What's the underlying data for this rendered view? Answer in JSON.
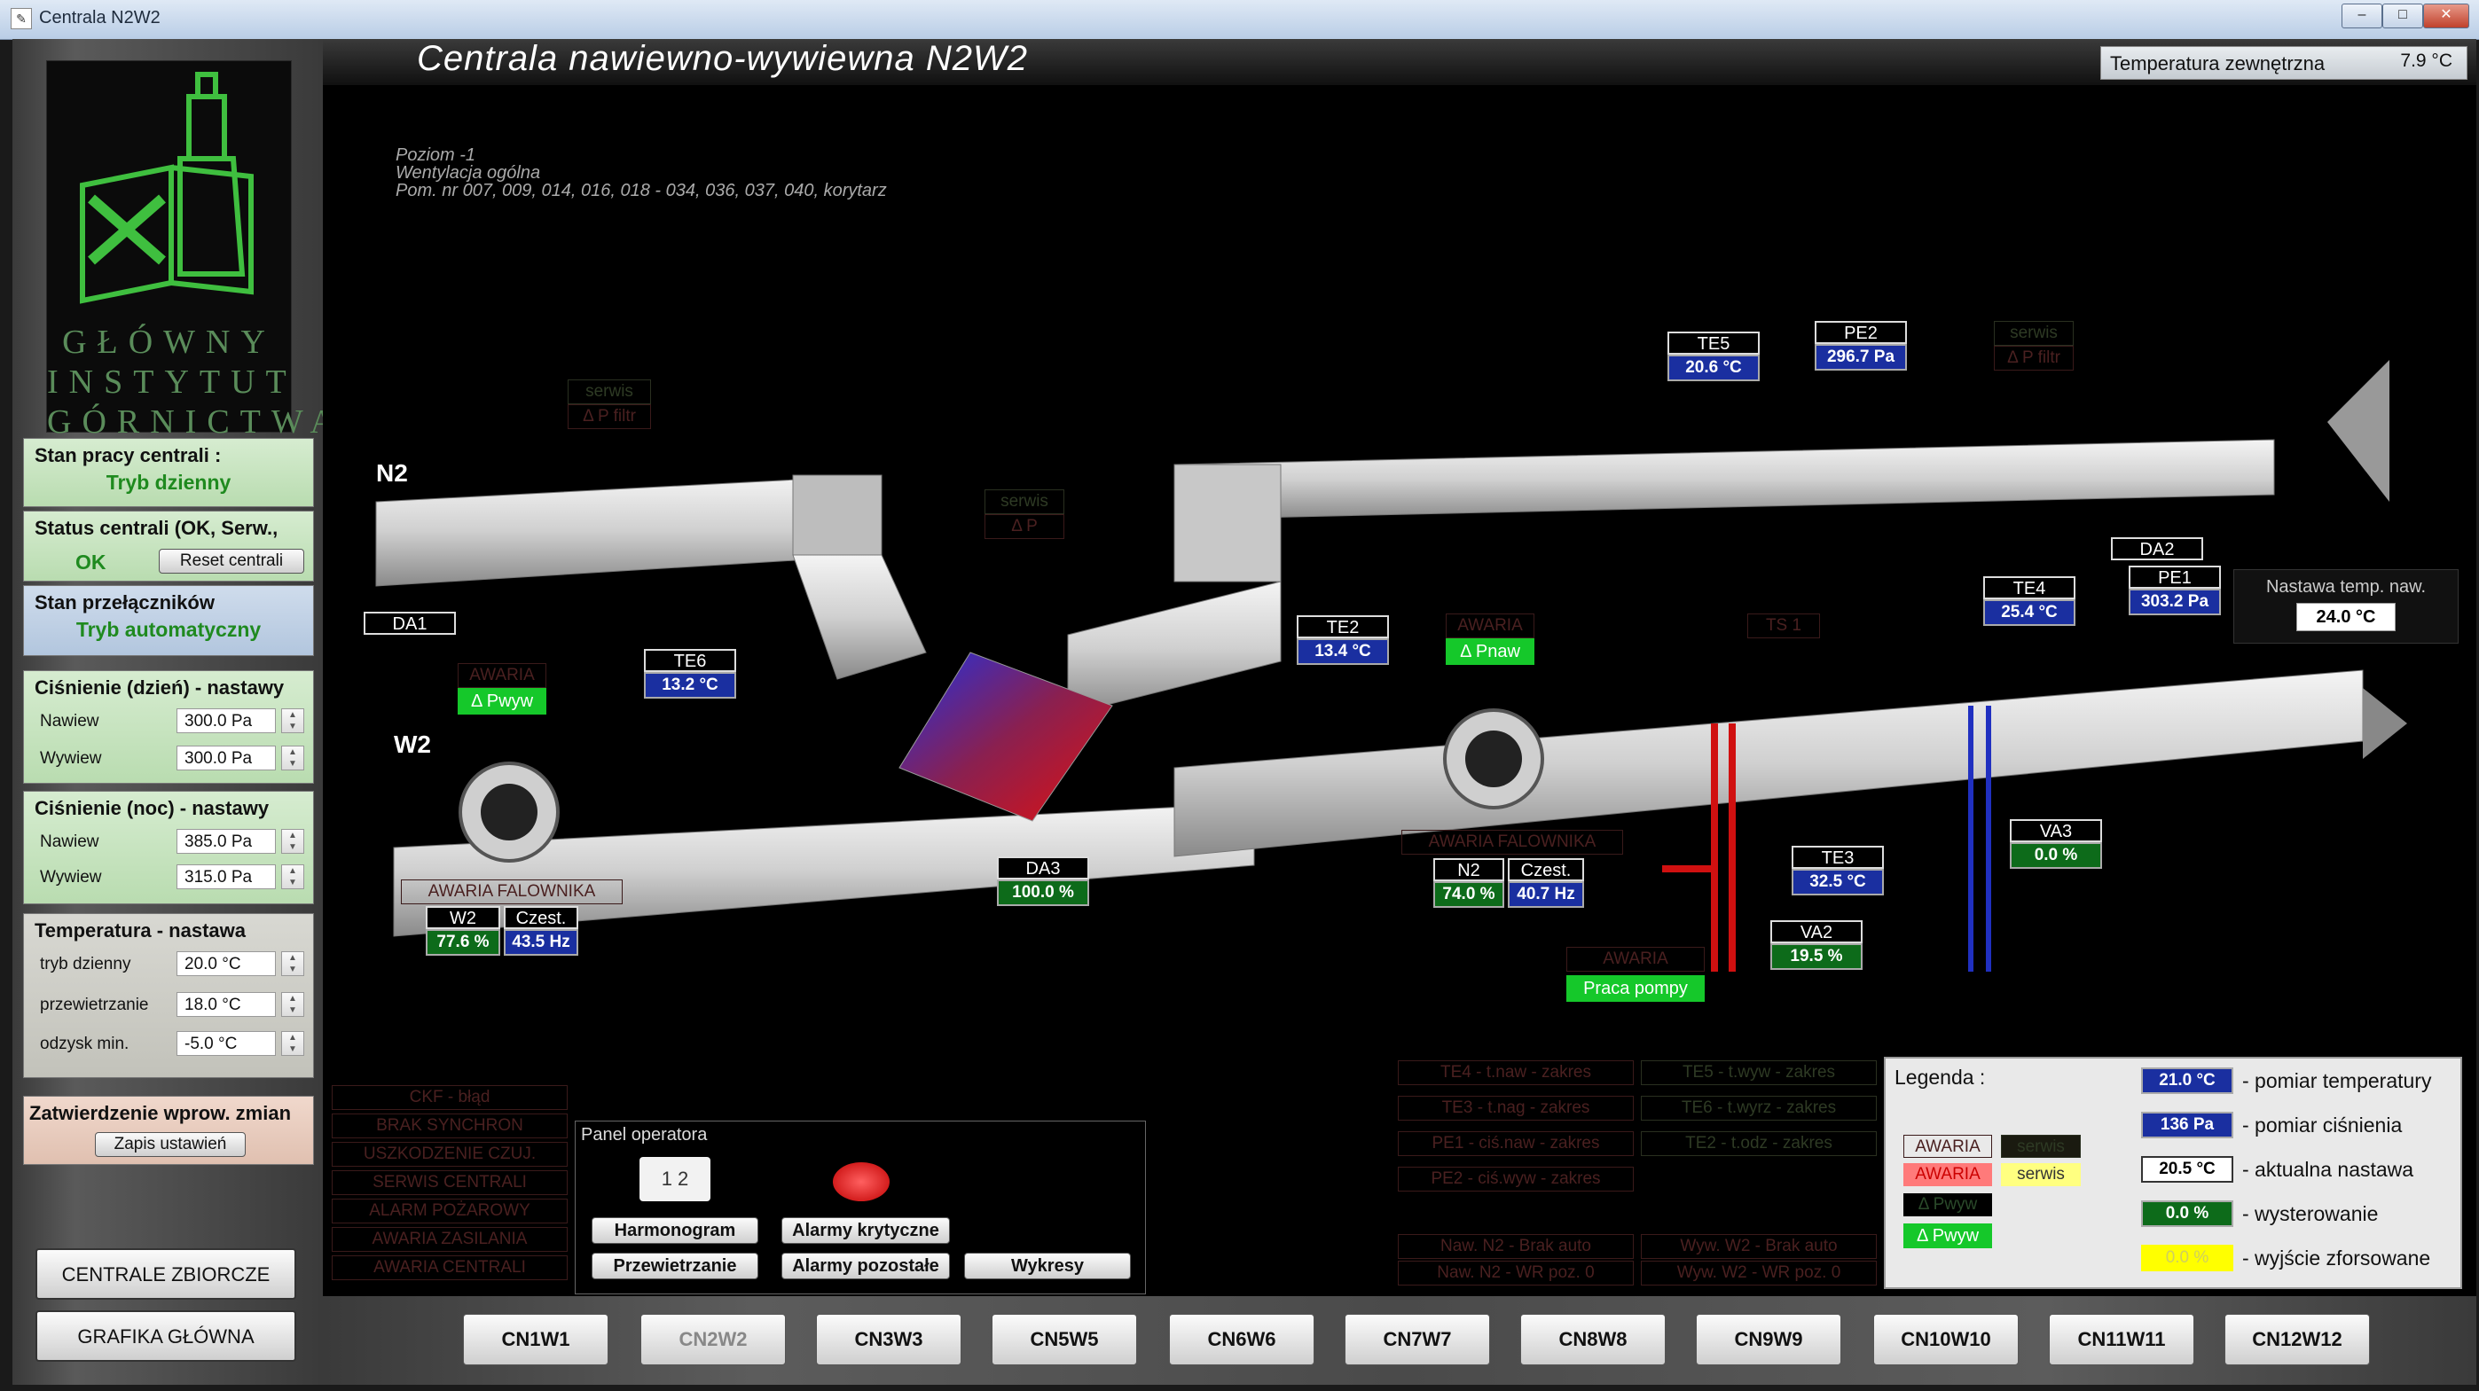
{
  "window": {
    "title": "Centrala N2W2",
    "min": "–",
    "max": "□",
    "close": "✕"
  },
  "header": {
    "title": "Centrala nawiewno-wywiewna N2W2",
    "outdoor_label": "Temperatura zewnętrzna",
    "outdoor_value": "7.9 °C"
  },
  "info": {
    "line1": "Poziom -1",
    "line2": "Wentylacja ogólna",
    "line3": "Pom. nr 007, 009, 014, 016, 018 - 034, 036, 037, 040, korytarz"
  },
  "logo": {
    "l1": "GŁÓWNY",
    "l2": "INSTYTUT",
    "l3": "GÓRNICTWA"
  },
  "left": {
    "work_state_title": "Stan pracy centrali :",
    "work_state_value": "Tryb dzienny",
    "status_title": "Status centrali (OK, Serw.,",
    "status_value": "OK",
    "reset_label": "Reset centrali",
    "switches_title": "Stan przełączników",
    "switches_value": "Tryb automatyczny",
    "pressure_day": {
      "title": "Ciśnienie (dzień) - nastawy",
      "rows": [
        {
          "label": "Nawiew",
          "value": "300.0 Pa"
        },
        {
          "label": "Wywiew",
          "value": "300.0 Pa"
        }
      ]
    },
    "pressure_night": {
      "title": "Ciśnienie (noc) - nastawy",
      "rows": [
        {
          "label": "Nawiew",
          "value": "385.0 Pa"
        },
        {
          "label": "Wywiew",
          "value": "315.0 Pa"
        }
      ]
    },
    "temperature": {
      "title": "Temperatura - nastawa",
      "rows": [
        {
          "label": "tryb dzienny",
          "value": "20.0 °C"
        },
        {
          "label": "przewietrzanie",
          "value": "18.0 °C"
        },
        {
          "label": "odzysk min.",
          "value": "-5.0 °C"
        }
      ]
    },
    "confirm_title": "Zatwierdzenie wprow. zmian",
    "save_label": "Zapis ustawień",
    "btn_central": "CENTRALE ZBIORCZE",
    "btn_graphic": "GRAFIKA GŁÓWNA"
  },
  "diagram": {
    "n2_label": "N2",
    "w2_label": "W2",
    "da1": "DA1",
    "da2": "DA2",
    "da3": "DA3",
    "da3_value": "100.0 %",
    "te1": {
      "tag": "TE5",
      "value": "20.6 °C"
    },
    "pe2": {
      "tag": "PE2",
      "value": "296.7 Pa"
    },
    "te2": {
      "tag": "TE2",
      "value": "13.4 °C"
    },
    "te6": {
      "tag": "TE6",
      "value": "13.2 °C"
    },
    "te4": {
      "tag": "TE4",
      "value": "25.4 °C"
    },
    "pe1": {
      "tag": "PE1",
      "value": "303.2 Pa"
    },
    "te3": {
      "tag": "TE3",
      "value": "32.5 °C"
    },
    "va2": {
      "tag": "VA2",
      "value": "19.5 %"
    },
    "va3": {
      "tag": "VA3",
      "value": "0.0 %"
    },
    "n2_fan": {
      "tag": "N2",
      "out": "74.0 %",
      "freq_tag": "Czest.",
      "freq": "40.7 Hz"
    },
    "w2_fan": {
      "tag": "W2",
      "out": "77.6 %",
      "freq_tag": "Czest.",
      "freq": "43.5 Hz"
    },
    "setpoint_label": "Nastawa temp. naw.",
    "setpoint_value": "24.0 °C",
    "serwis1": "serwis",
    "pfiltr1": "Δ P filtr",
    "serwis2": "serwis",
    "p2": "Δ P",
    "serwis3": "serwis",
    "pfiltr3": "Δ P filtr",
    "awaria_pwyw": "AWARIA",
    "pwyw": "Δ Pwyw",
    "awaria_pnaw": "AWARIA",
    "pnaw": "Δ Pnaw",
    "ts1": "TS 1",
    "awaria_fal_w": "AWARIA FALOWNIKA",
    "awaria_fal_n": "AWARIA FALOWNIKA",
    "awaria_pump": "AWARIA",
    "pump_running": "Praca pompy"
  },
  "alarms_left": [
    "CKF - błąd",
    "BRAK SYNCHRON",
    "USZKODZENIE CZUJ.",
    "SERWIS CENTRALI",
    "ALARM POŻAROWY",
    "AWARIA ZASILANIA",
    "AWARIA CENTRALI"
  ],
  "alarms_mid": [
    "TE4 - t.naw - zakres",
    "TE3 - t.nag - zakres",
    "PE1 - ciś.naw - zakres",
    "PE2 - ciś.wyw - zakres"
  ],
  "alarms_mid2": [
    "TE5 - t.wyw - zakres",
    "TE6 - t.wyrz - zakres",
    "TE2 - t.odz - zakres"
  ],
  "alarms_bottom": [
    "Naw. N2 - Brak auto",
    "Naw. N2 - WR poz. 0",
    "Wyw. W2 - Brak auto",
    "Wyw. W2 - WR poz. 0"
  ],
  "operator": {
    "title": "Panel operatora",
    "harmonogram": "Harmonogram",
    "przewietrzanie": "Przewietrzanie",
    "alarmy_kryt": "Alarmy krytyczne",
    "alarmy_poz": "Alarmy pozostałe",
    "wykresy": "Wykresy"
  },
  "legend": {
    "title": "Legenda :",
    "awaria_dim": "AWARIA",
    "serwis_dim": "serwis",
    "awaria": "AWARIA",
    "serwis": "serwis",
    "pwyw_dim": "Δ Pwyw",
    "pwyw": "Δ Pwyw",
    "temp_val": "21.0 °C",
    "temp_desc": "- pomiar temperatury",
    "press_val": "136 Pa",
    "press_desc": "- pomiar ciśnienia",
    "set_val": "20.5 °C",
    "set_desc": "- aktualna nastawa",
    "ctrl_val": "0.0 %",
    "ctrl_desc": "- wysterowanie",
    "force_val": "0.0 %",
    "force_desc": "- wyjście zforsowane"
  },
  "tabs": [
    "CN1W1",
    "CN2W2",
    "CN3W3",
    "CN5W5",
    "CN6W6",
    "CN7W7",
    "CN8W8",
    "CN9W9",
    "CN10W10",
    "CN11W11",
    "CN12W12"
  ],
  "colors": {
    "measure": "#1a2fa0",
    "output": "#0d6b1a",
    "alarm": "#15c82a"
  }
}
